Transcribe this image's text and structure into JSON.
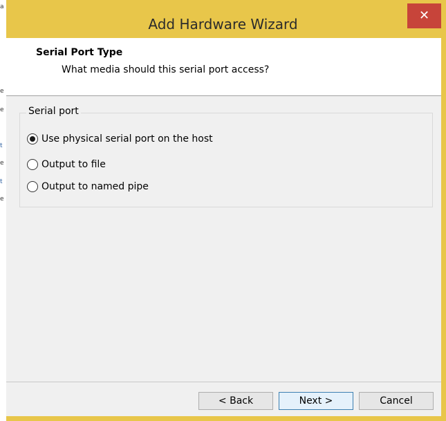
{
  "window": {
    "title": "Add Hardware Wizard",
    "close_glyph": "✕"
  },
  "background_window_glyphs": [
    "a",
    "e",
    "e",
    "t",
    "e",
    "t",
    "e"
  ],
  "header": {
    "title": "Serial Port Type",
    "subtitle": "What media should this serial port access?"
  },
  "serial_port_group": {
    "label": "Serial port",
    "options": [
      {
        "label": "Use physical serial port on the host",
        "selected": true
      },
      {
        "label": "Output to file",
        "selected": false
      },
      {
        "label": "Output to named pipe",
        "selected": false
      }
    ]
  },
  "buttons": {
    "back": "< Back",
    "next": "Next >",
    "cancel": "Cancel"
  },
  "colors": {
    "frame": "#e8c64a",
    "close_button": "#c7443a",
    "default_button_border": "#3c7fb1"
  }
}
